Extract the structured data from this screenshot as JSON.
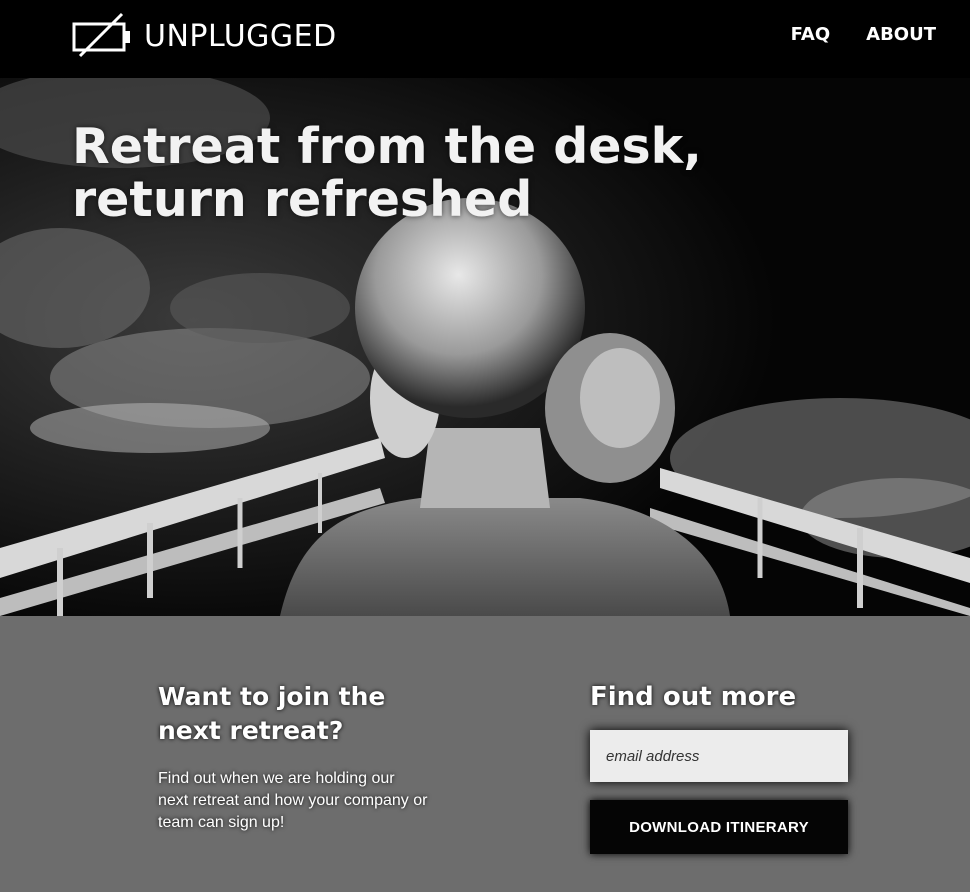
{
  "header": {
    "logo_text": "UNPLUGGED",
    "logo_icon": "battery-empty-icon",
    "nav": [
      {
        "label": "FAQ"
      },
      {
        "label": "ABOUT"
      }
    ]
  },
  "hero": {
    "title": "Retreat from the desk,\nreturn refreshed"
  },
  "join": {
    "title": "Want to join the\nnext retreat?",
    "text": "Find out when we are holding our next retreat and how your company or team can sign up!"
  },
  "more": {
    "title": "Find out more",
    "email_placeholder": "email address",
    "button_label": "DOWNLOAD ITINERARY"
  }
}
